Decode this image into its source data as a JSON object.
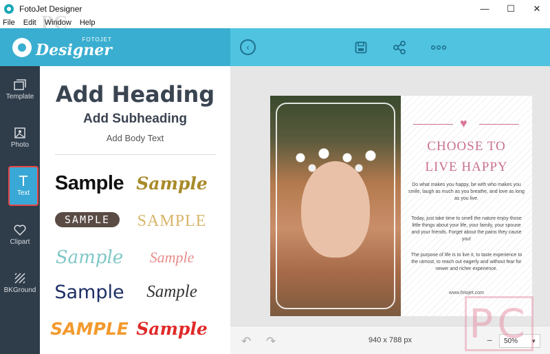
{
  "window": {
    "title": "FotoJet Designer",
    "minimize": "—",
    "maximize": "☐",
    "close": "✕"
  },
  "menu": [
    "File",
    "Edit",
    "Window",
    "Help"
  ],
  "watermark_top": "PC",
  "logo": {
    "small": "FOTOJET",
    "big": "Designer"
  },
  "tools": [
    {
      "label": "Template",
      "icon": "template-icon"
    },
    {
      "label": "Photo",
      "icon": "photo-icon"
    },
    {
      "label": "Text",
      "icon": "text-icon",
      "active": true
    },
    {
      "label": "Clipart",
      "icon": "heart-icon"
    },
    {
      "label": "BKGround",
      "icon": "background-icon"
    }
  ],
  "text_panel": {
    "heading": "Add Heading",
    "subheading": "Add Subheading",
    "body": "Add Body Text",
    "samples": [
      "Sample",
      "Sample",
      "SAMPLE",
      "SAMPLE",
      "Sample",
      "Sample",
      "Sample",
      "Sample",
      "SAMPLE",
      "Sample"
    ]
  },
  "design": {
    "title_line1": "CHOOSE TO",
    "title_line2": "LIVE HAPPY",
    "para1": "Do what makes you happy, be with who makes you smile, laugh as much as you breathe, and love as long as you live.",
    "para2": "Today, just take time to smell the nature enjoy those little things about your life, your family, your spouse and your friends. Forget about the pains they cause you!",
    "para3": "The purpose of life is to live it, to taste experience to the utmost, to reach out eagerly and without fear for newer and richer experience.",
    "site": "www.fotojet.com"
  },
  "bottom": {
    "size": "940 x 788 px",
    "zoom": "50%"
  },
  "watermark_bottom": "PC",
  "colors": {
    "accent": "#4fc3e0",
    "sidebar": "#2f3c4a",
    "title_pink": "#c9718f"
  }
}
